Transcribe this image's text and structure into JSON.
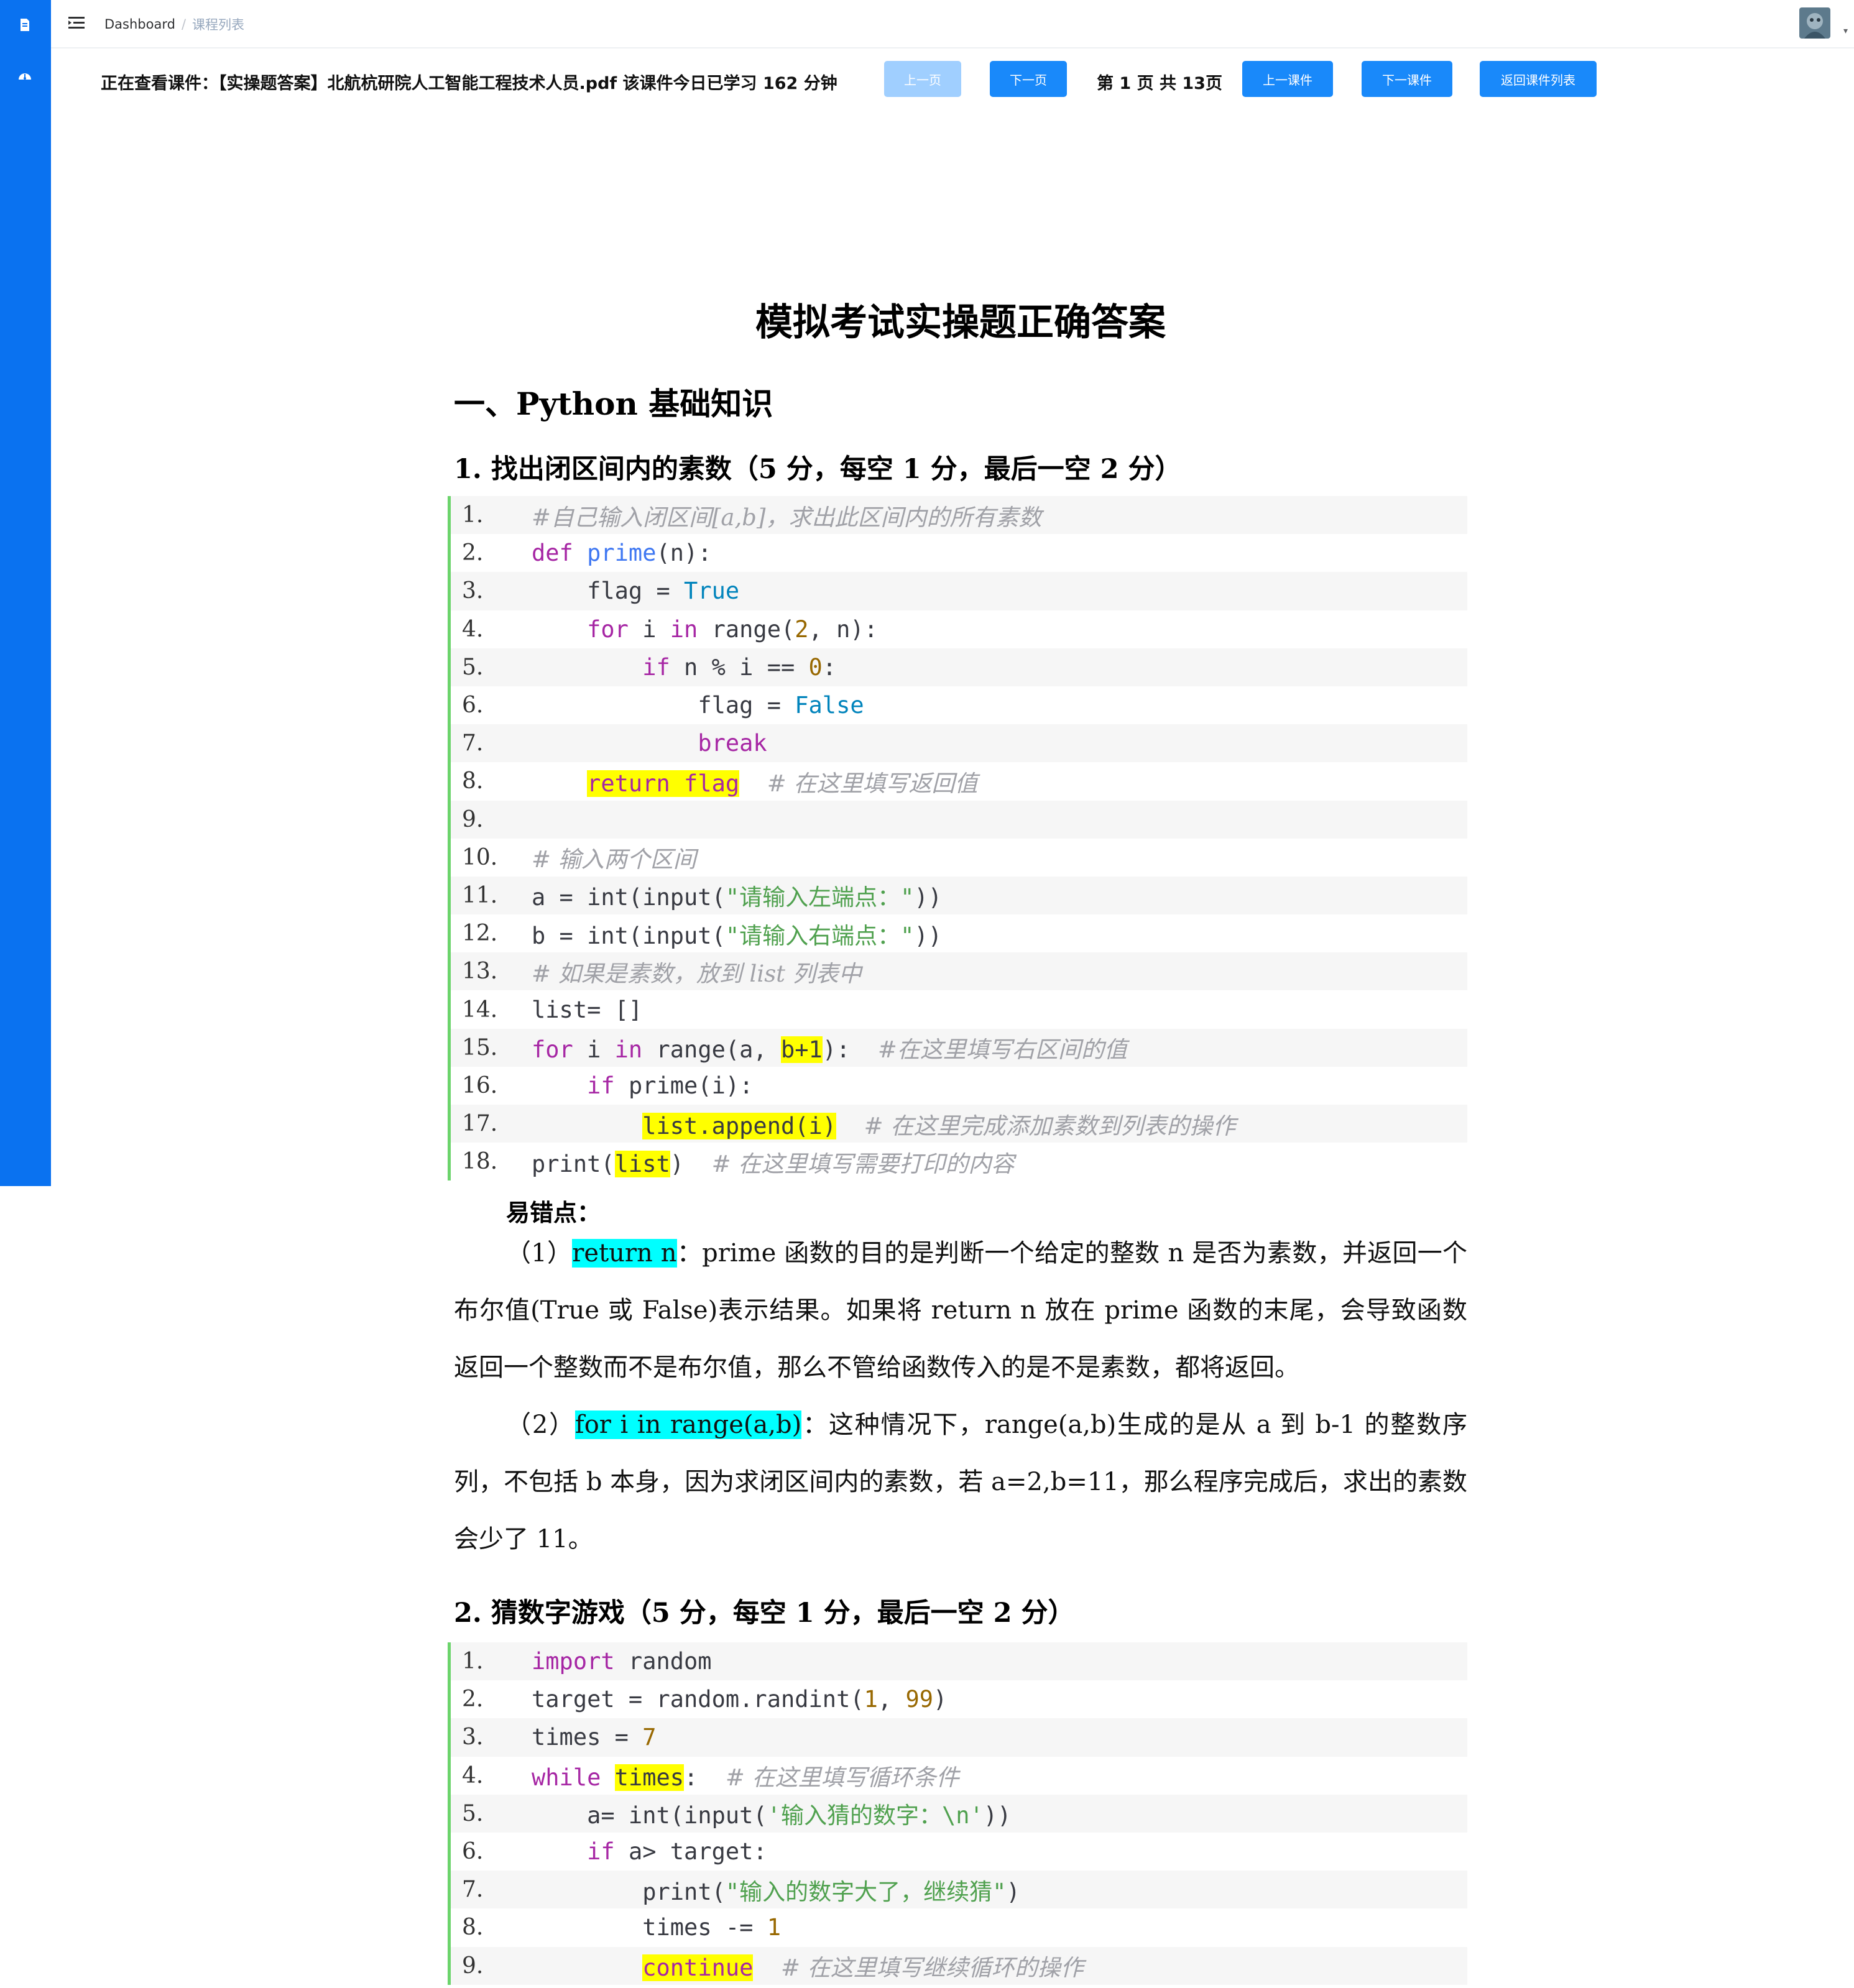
{
  "colors": {
    "sidebar": "#0a72f0",
    "primary_button": "#1989fa",
    "disabled_button": "#a0cfff",
    "code_border": "#6cd46c",
    "highlight": "#ffff00",
    "highlight_cyan": "#00ffff"
  },
  "sidebar": {
    "icons": [
      "document-icon",
      "dashboard-icon"
    ]
  },
  "header": {
    "breadcrumb": {
      "home": "Dashboard",
      "separator": "/",
      "current": "课程列表"
    }
  },
  "viewer": {
    "viewing_text": "正在查看课件：【实操题答案】北航杭研院人工智能工程技术人员.pdf 该课件今日已学习 162 分钟",
    "prev_page": "上一页",
    "next_page": "下一页",
    "page_info": "第 1 页 共 13页",
    "prev_course": "上一课件",
    "next_course": "下一课件",
    "back_to_list": "返回课件列表"
  },
  "document": {
    "title": "模拟考试实操题正确答案",
    "section1": "一、Python 基础知识",
    "q1_title": "1.  找出闭区间内的素数（5 分，每空 1 分，最后一空 2 分）",
    "q1_lines": [
      "1.",
      "2.",
      "3.",
      "4.",
      "5.",
      "6.",
      "7.",
      "8.",
      "9.",
      "10.",
      "11.",
      "12.",
      "13.",
      "14.",
      "15.",
      "16.",
      "17.",
      "18."
    ],
    "q1_code": {
      "c1": "#自己输入闭区间[a,b]，求出此区间内的所有素数",
      "l2_def": "def",
      "l2_fn": "prime",
      "l2_rest": "(n):",
      "l3_a": "flag = ",
      "l3_b": "True",
      "l4_for": "for",
      "l4_a": " i ",
      "l4_in": "in",
      "l4_b": " range(",
      "l4_n": "2",
      "l4_c": ", n):",
      "l5_if": "if",
      "l5_a": " n % i == ",
      "l5_n": "0",
      "l5_b": ":",
      "l6_a": "flag = ",
      "l6_b": "False",
      "l7": "break",
      "l8_hl": "return flag",
      "l8_cm": "# 在这里填写返回值",
      "l10": "# 输入两个区间",
      "l11_a": "a = int(input(",
      "l11_s": "\"请输入左端点：\"",
      "l11_b": "))",
      "l12_a": "b = int(input(",
      "l12_s": "\"请输入右端点：\"",
      "l12_b": "))",
      "l13": "# 如果是素数，放到 list 列表中",
      "l14": "list= []",
      "l15_for": "for",
      "l15_a": " i ",
      "l15_in": "in",
      "l15_b": " range(a, ",
      "l15_hl": "b+1",
      "l15_c": "):  ",
      "l15_cm": "#在这里填写右区间的值",
      "l16_if": "if",
      "l16_a": " prime(i):",
      "l17_hl": "list.append(i)",
      "l17_cm": "# 在这里完成添加素数到列表的操作",
      "l18_a": "print(",
      "l18_hl": "list",
      "l18_b": ")  ",
      "l18_cm": "# 在这里填写需要打印的内容"
    },
    "note_label": "易错点：",
    "note1_prefix": "（1）",
    "note1_hl": "return n",
    "note1_text": "：prime 函数的目的是判断一个给定的整数 n 是否为素数，并返回一个布尔值(True 或 False)表示结果。如果将 return n 放在 prime 函数的末尾，会导致函数返回一个整数而不是布尔值，那么不管给函数传入的是不是素数，都将返回。",
    "note2_prefix": "（2）",
    "note2_hl": "for i in range(a,b)",
    "note2_text": "：这种情况下，range(a,b)生成的是从 a 到 b-1 的整数序列，不包括 b 本身，因为求闭区间内的素数，若 a=2,b=11，那么程序完成后，求出的素数会少了 11。",
    "q2_title": "2.  猜数字游戏（5 分，每空 1 分，最后一空 2 分）",
    "q2_lines": [
      "1.",
      "2.",
      "3.",
      "4.",
      "5.",
      "6.",
      "7.",
      "8.",
      "9."
    ],
    "q2_code": {
      "l1_kw": "import",
      "l1_a": " random",
      "l2_a": "target = random.randint(",
      "l2_n1": "1",
      "l2_b": ", ",
      "l2_n2": "99",
      "l2_c": ")",
      "l3_a": "times = ",
      "l3_n": "7",
      "l4_kw": "while",
      "l4_hl": "times",
      "l4_b": ":  ",
      "l4_cm": "# 在这里填写循环条件",
      "l5_a": "a= int(input(",
      "l5_s": "'输入猜的数字：\\n'",
      "l5_b": "))",
      "l6_kw": "if",
      "l6_a": " a> target:",
      "l7_a": "print(",
      "l7_s": "\"输入的数字大了，继续猜\"",
      "l7_b": ")",
      "l8_a": "times -= ",
      "l8_n": "1",
      "l9_hl": "continue",
      "l9_cm": "# 在这里填写继续循环的操作"
    }
  }
}
